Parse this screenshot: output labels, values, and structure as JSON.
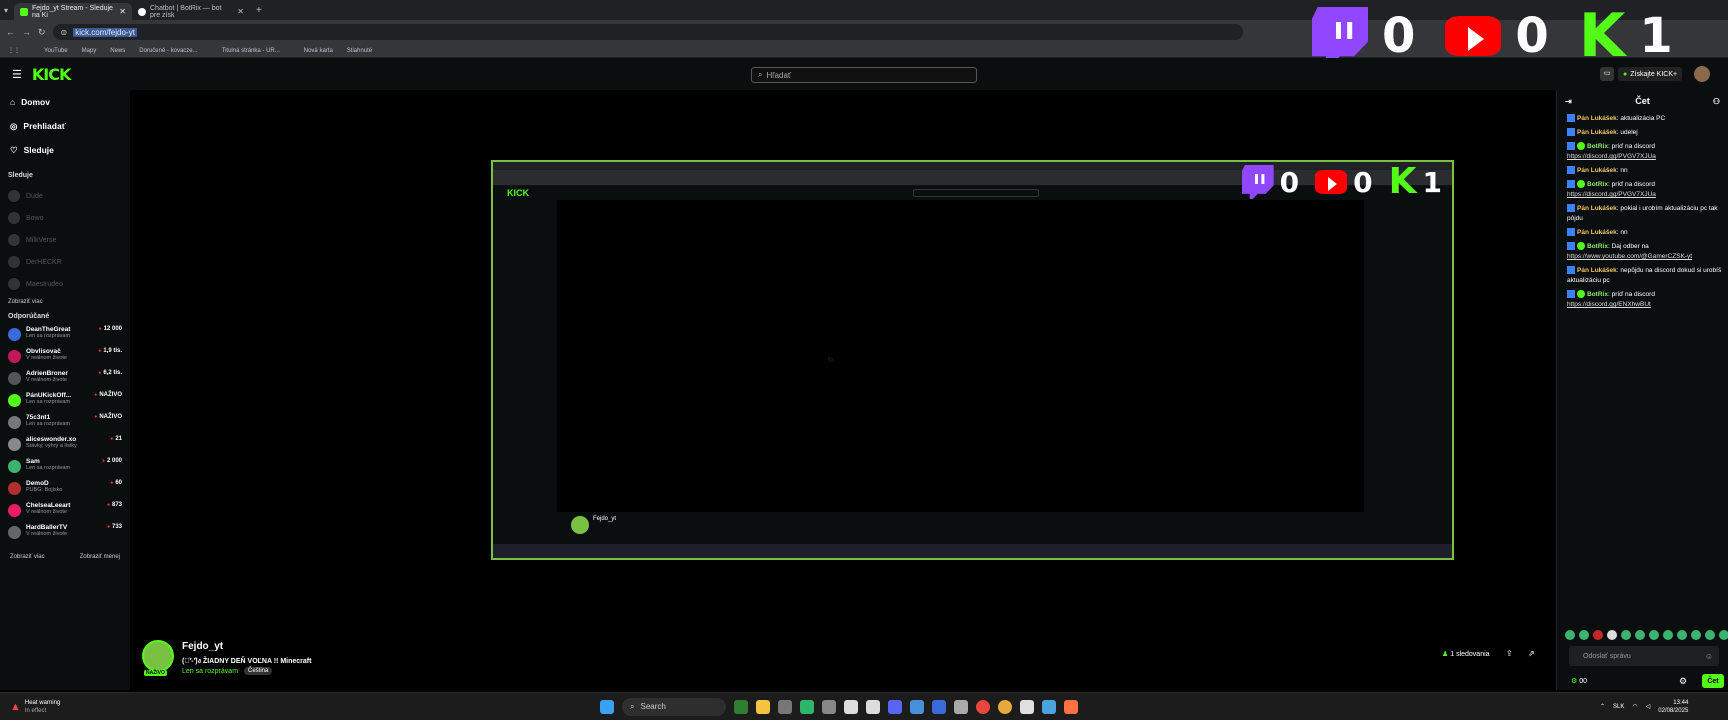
{
  "browser": {
    "tabs": [
      {
        "title": "Fejdo_yt Stream - Sleduje na Ki",
        "favicon_color": "#53fc18",
        "active": true
      },
      {
        "title": "Chatbot | BotRix — bot pre získ",
        "favicon_color": "#ffffff",
        "active": false
      }
    ],
    "url": "kick.com/fejdo-yt",
    "bookmarks": [
      "YouTube",
      "Mapy",
      "News",
      "Doručené - kovacze...",
      "Titulná stránka - UR...",
      "Nová karta",
      "Stiahnuté"
    ]
  },
  "counters": {
    "twitch": "0",
    "youtube": "0",
    "kick": "1"
  },
  "header": {
    "logo": "KICK",
    "search_placeholder": "Hľadať",
    "subscribe_label": "Získajte KICK+"
  },
  "sidebar": {
    "nav": [
      {
        "label": "Domov",
        "icon": "home-icon"
      },
      {
        "label": "Prehliadať",
        "icon": "compass-icon"
      },
      {
        "label": "Sleduje",
        "icon": "heart-icon"
      }
    ],
    "following_title": "Sleduje",
    "following": [
      "Dude",
      "Bowo",
      "MilkVerse",
      "DerHECKR",
      "Maestrudeo"
    ],
    "show_all": "Zobraziť viac",
    "recommended_title": "Odporúčané",
    "recommended": [
      {
        "name": "DeanTheGreat",
        "sub": "Len sa rozprávam",
        "viewers": "12 000",
        "color": "#3a6ad9"
      },
      {
        "name": "Obvlisovač",
        "sub": "V reálnom živote",
        "viewers": "1,9 tis.",
        "color": "#c2185b"
      },
      {
        "name": "AdrienBroner",
        "sub": "V reálnom živote",
        "viewers": "6,2 tis.",
        "color": "#555555"
      },
      {
        "name": "PánUKickOff...",
        "sub": "Len sa rozprávam",
        "viewers": "NAŽIVO",
        "color": "#53fc18"
      },
      {
        "name": "75c3nt1",
        "sub": "Len sa rozprávam",
        "viewers": "NAŽIVO",
        "color": "#777777"
      },
      {
        "name": "aliceswonder.xo",
        "sub": "Stávky, výhry a lístky",
        "viewers": "21",
        "color": "#888888"
      },
      {
        "name": "Sam",
        "sub": "Len sa rozprávam",
        "viewers": "2 000",
        "color": "#3cb371"
      },
      {
        "name": "DemoD",
        "sub": "PUBG: Bojisko",
        "viewers": "60",
        "color": "#b03030"
      },
      {
        "name": "ChelseaLeeart",
        "sub": "V reálnom živote",
        "viewers": "873",
        "color": "#e91e63"
      },
      {
        "name": "HardBallerTV",
        "sub": "V reálnom živote",
        "viewers": "733",
        "color": "#666666"
      }
    ],
    "show_more": "Zobraziť viac",
    "show_less": "Zobraziť menej"
  },
  "stream": {
    "channel": "Fejdo_yt",
    "title": "(ง︡'-'︠)ง ŽIADNY DEŇ VOĽNA !! Minecraft",
    "category": "Len sa rozprávam",
    "tag": "Čeština",
    "live_label": "NAŽIVO",
    "followers": "1 sledovania"
  },
  "chat": {
    "title": "Čet",
    "messages": [
      {
        "user": "Pán Lukášek",
        "bot": false,
        "text": "aktualizácia PC",
        "link": ""
      },
      {
        "user": "Pán Lukášek",
        "bot": false,
        "text": "udelej",
        "link": ""
      },
      {
        "user": "BotRix",
        "bot": true,
        "text": "príď na discord",
        "link": "https://discord.gg/PVGV7XJUa"
      },
      {
        "user": "Pán Lukášek",
        "bot": false,
        "text": "nn",
        "link": ""
      },
      {
        "user": "BotRix",
        "bot": true,
        "text": "príď na discord",
        "link": "https://discord.gg/PVGV7XJUa"
      },
      {
        "user": "Pán Lukášek",
        "bot": false,
        "text": "pokial i urobím aktualizáciu pc tak pôjdu",
        "link": ""
      },
      {
        "user": "Pán Lukášek",
        "bot": false,
        "text": "nn",
        "link": ""
      },
      {
        "user": "BotRix",
        "bot": true,
        "text": "Daj odber na",
        "link": "https://www.youtube.com/@GamerCZSK-yt"
      },
      {
        "user": "Pán Lukášek",
        "bot": false,
        "text": "nepôjdu na discord dokud si urobíš aktualizáciu pc",
        "link": ""
      },
      {
        "user": "BotRix",
        "bot": true,
        "text": "príď na discord",
        "link": "https://discord.gg/ENXhwBUt"
      }
    ],
    "input_placeholder": "Odoslať správu",
    "send_label": "Čet",
    "points": "00"
  },
  "taskbar": {
    "weather": "Heat warning",
    "weather_sub": "In effect",
    "search": "Search",
    "language": "SLK",
    "time": "13:44",
    "date": "02/08/2025"
  }
}
